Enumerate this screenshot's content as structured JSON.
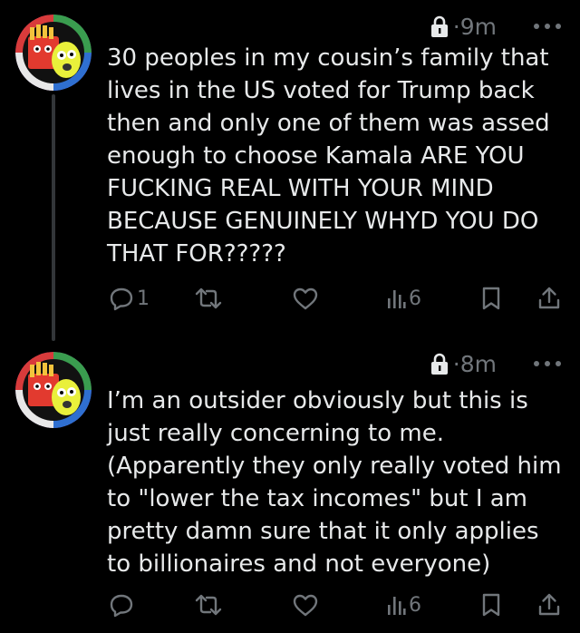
{
  "posts": [
    {
      "timestamp": "9m",
      "separator": "·",
      "text": "30 peoples in my cousin’s family that\nlives in the US voted for Trump back\nthen and only one of them was assed\nenough to choose Kamala ARE YOU\nFUCKING REAL WITH YOUR MIND\nBECAUSE GENUINELY WHYD YOU DO\nTHAT FOR?????",
      "actions": {
        "reply_count": "1",
        "retweet_count": "",
        "like_count": "",
        "view_count": "6"
      }
    },
    {
      "timestamp": "8m",
      "separator": "·",
      "text": "I’m an outsider obviously but this is\njust really concerning to me.\n(Apparently they only really voted him\nto \"lower the tax incomes\" but I am\npretty damn sure that it only applies\nto billionaires and not everyone)",
      "actions": {
        "reply_count": "",
        "retweet_count": "",
        "like_count": "",
        "view_count": "6"
      }
    }
  ],
  "icons": {
    "lock": "lock-icon",
    "more": "more-horizontal-icon",
    "reply": "reply-icon",
    "retweet": "retweet-icon",
    "like": "heart-icon",
    "views": "analytics-icon",
    "bookmark": "bookmark-icon",
    "share": "share-icon"
  },
  "colors": {
    "background": "#000000",
    "text_primary": "#e7e9ea",
    "text_secondary": "#71767b",
    "thread_line": "#333639"
  }
}
